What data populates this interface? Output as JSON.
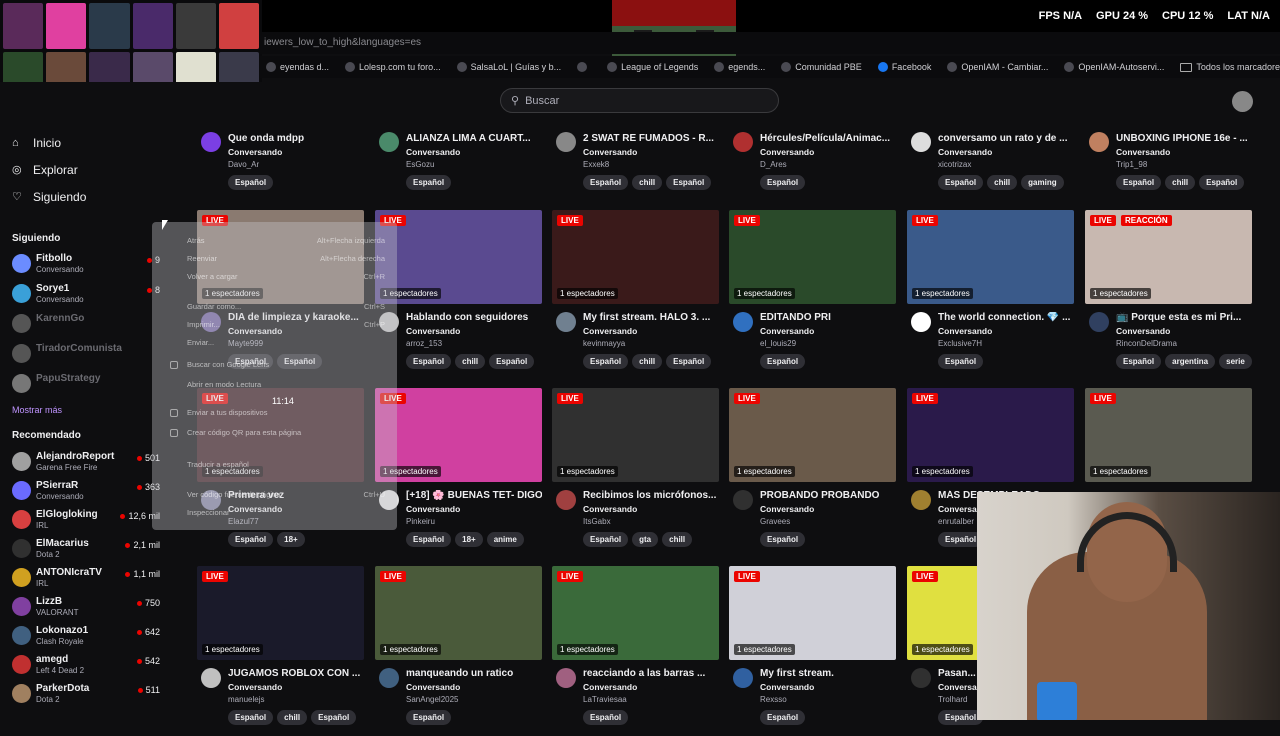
{
  "overlay": {
    "url": "iewers_low_to_high&languages=es",
    "stats": [
      {
        "label": "FPS",
        "value": "N/A"
      },
      {
        "label": "GPU",
        "value": "24 %"
      },
      {
        "label": "CPU",
        "value": "12 %"
      },
      {
        "label": "LAT",
        "value": "N/A"
      }
    ],
    "stream_time": "11:14"
  },
  "bookmarks": [
    {
      "label": "eyendas d...",
      "icon": "page-icon"
    },
    {
      "label": "Lolesp.com tu foro...",
      "icon": "page-icon"
    },
    {
      "label": "SalsaLoL | Guías y b...",
      "icon": "page-icon"
    },
    {
      "label": "",
      "icon": "page-icon"
    },
    {
      "label": "League of Legends",
      "icon": "page-icon"
    },
    {
      "label": "egends...",
      "icon": "page-icon"
    },
    {
      "label": "Comunidad PBE",
      "icon": "page-icon"
    },
    {
      "label": "Facebook",
      "icon": "facebook-icon"
    },
    {
      "label": "OpenIAM - Cambiar...",
      "icon": "page-icon"
    },
    {
      "label": "OpenIAM-Autoservi...",
      "icon": "page-icon"
    }
  ],
  "bookmarks_all": "Todos los marcadores",
  "search": {
    "placeholder": "Buscar"
  },
  "nav": {
    "home": "Inicio",
    "explore": "Explorar",
    "following": "Siguiendo"
  },
  "sidebar": {
    "following_title": "Siguiendo",
    "following": [
      {
        "name": "Fitbollo",
        "game": "Conversando",
        "viewers": "9",
        "online": true,
        "color": "#6b8cff"
      },
      {
        "name": "Sorye1",
        "game": "Conversando",
        "viewers": "8",
        "online": true,
        "color": "#3aa0d8"
      },
      {
        "name": "KarennGo",
        "game": "",
        "viewers": "",
        "online": false,
        "color": "#555"
      },
      {
        "name": "TiradorComunista",
        "game": "",
        "viewers": "",
        "online": false,
        "color": "#555"
      },
      {
        "name": "PapuStrategy",
        "game": "",
        "viewers": "",
        "online": false,
        "color": "#777"
      }
    ],
    "more_label": "Mostrar más",
    "recommended_title": "Recomendado",
    "recommended": [
      {
        "name": "AlejandroReport",
        "game": "Garena Free Fire",
        "viewers": "501",
        "color": "#a0a0a0"
      },
      {
        "name": "PSierraR",
        "game": "Conversando",
        "viewers": "363",
        "color": "#6b6bff"
      },
      {
        "name": "ElGlogloking",
        "game": "IRL",
        "viewers": "12,6 mil",
        "color": "#d84040"
      },
      {
        "name": "ElMacarius",
        "game": "Dota 2",
        "viewers": "2,1 mil",
        "color": "#303030"
      },
      {
        "name": "ANTONIcraTV",
        "game": "IRL",
        "viewers": "1,1 mil",
        "color": "#d0a020"
      },
      {
        "name": "LizzB",
        "game": "VALORANT",
        "viewers": "750",
        "color": "#8040a0"
      },
      {
        "name": "Lokonazo1",
        "game": "Clash Royale",
        "viewers": "642",
        "color": "#406080"
      },
      {
        "name": "amegd",
        "game": "Left 4 Dead 2",
        "viewers": "542",
        "color": "#c03030"
      },
      {
        "name": "ParkerDota",
        "game": "Dota 2",
        "viewers": "511",
        "color": "#a08060"
      }
    ]
  },
  "top_row": [
    {
      "title": "Que onda mdpp",
      "category": "Conversando",
      "user": "Davo_Ar",
      "tags": [
        "Español"
      ],
      "color": "#7b3fe4"
    },
    {
      "title": "ALIANZA LIMA A CUART...",
      "category": "Conversando",
      "user": "EsGozu",
      "tags": [
        "Español"
      ],
      "color": "#4a8a6a"
    },
    {
      "title": "2 SWAT RE FUMADOS - R...",
      "category": "Conversando",
      "user": "Exxek8",
      "tags": [
        "Español",
        "chill",
        "Español"
      ],
      "color": "#888"
    },
    {
      "title": "Hércules/Película/Animac...",
      "category": "Conversando",
      "user": "D_Ares",
      "tags": [
        "Español"
      ],
      "color": "#b03030"
    },
    {
      "title": "conversamo un rato y de ...",
      "category": "Conversando",
      "user": "xicotrizax",
      "tags": [
        "Español",
        "chill",
        "gaming"
      ],
      "color": "#ddd"
    },
    {
      "title": "UNBOXING IPHONE 16e - ...",
      "category": "Conversando",
      "user": "Trip1_98",
      "tags": [
        "Español",
        "chill",
        "Español"
      ],
      "color": "#c08060"
    }
  ],
  "streams": [
    {
      "title": "DIA de limpieza y karaoke...",
      "category": "Conversando",
      "user": "Mayte999",
      "views": "1 espectadores",
      "tags": [
        "Español",
        "Español"
      ],
      "reaction": "",
      "bg": "#8a7a70",
      "color": "#7060a0"
    },
    {
      "title": "Hablando con seguidores",
      "category": "Conversando",
      "user": "arroz_153",
      "views": "1 espectadores",
      "tags": [
        "Español",
        "chill",
        "Español"
      ],
      "reaction": "",
      "bg": "#5a4a90",
      "color": "#c0c0c0"
    },
    {
      "title": "My first stream. HALO 3. ...",
      "category": "Conversando",
      "user": "kevinmayya",
      "views": "1 espectadores",
      "tags": [
        "Español",
        "chill",
        "Español"
      ],
      "reaction": "",
      "bg": "#3a1a1a",
      "color": "#708090"
    },
    {
      "title": "EDITANDO PRI",
      "category": "Conversando",
      "user": "el_louis29",
      "views": "1 espectadores",
      "tags": [
        "Español"
      ],
      "reaction": "",
      "bg": "#2a4a2a",
      "color": "#3070c0"
    },
    {
      "title": "The world connection. 💎 ...",
      "category": "Conversando",
      "user": "Exclusive7H",
      "views": "1 espectadores",
      "tags": [
        "Español"
      ],
      "reaction": "",
      "bg": "#3a5a8a",
      "color": "#fff"
    },
    {
      "title": "📺 Porque esta es mi Pri...",
      "category": "Conversando",
      "user": "RinconDelDrama",
      "views": "1 espectadores",
      "tags": [
        "Español",
        "argentina",
        "serie"
      ],
      "reaction": "REACCIÓN",
      "bg": "#c8b8b0",
      "color": "#304060"
    },
    {
      "title": "Primera vez",
      "category": "Conversando",
      "user": "Elazul77",
      "views": "1 espectadores",
      "tags": [
        "Español",
        "18+"
      ],
      "reaction": "",
      "bg": "#3a1a20",
      "color": "#8080a0"
    },
    {
      "title": "[+18] 🌸 BUENAS TET- DIGO...",
      "category": "Conversando",
      "user": "Pinkeiru",
      "views": "1 espectadores",
      "tags": [
        "Español",
        "18+",
        "anime"
      ],
      "reaction": "",
      "bg": "#d040a0",
      "color": "#e0e0e0"
    },
    {
      "title": "Recibimos los micrófonos...",
      "category": "Conversando",
      "user": "ItsGabx",
      "views": "1 espectadores",
      "tags": [
        "Español",
        "gta",
        "chill"
      ],
      "reaction": "",
      "bg": "#303030",
      "color": "#a04040"
    },
    {
      "title": "PROBANDO PROBANDO",
      "category": "Conversando",
      "user": "Gravees",
      "views": "1 espectadores",
      "tags": [
        "Español"
      ],
      "reaction": "",
      "bg": "#6a5a4a",
      "color": "#303030"
    },
    {
      "title": "MÁS DESEMPLEADO...",
      "category": "Conversando",
      "user": "enrutalber",
      "views": "1 espectadores",
      "tags": [
        "Español"
      ],
      "reaction": "",
      "bg": "#2a1a4a",
      "color": "#a08030"
    },
    {
      "title": "",
      "category": "",
      "user": "",
      "views": "1 espectadores",
      "tags": [],
      "reaction": "",
      "bg": "#5a5a50",
      "color": "#0e0e10"
    },
    {
      "title": "JUGAMOS ROBLOX CON ...",
      "category": "Conversando",
      "user": "manuelejs",
      "views": "1 espectadores",
      "tags": [
        "Español",
        "chill",
        "Español"
      ],
      "reaction": "",
      "bg": "#1a1a2a",
      "color": "#c0c0c0"
    },
    {
      "title": "manqueando un ratico",
      "category": "Conversando",
      "user": "SanAngel2025",
      "views": "1 espectadores",
      "tags": [
        "Español"
      ],
      "reaction": "",
      "bg": "#4a5a3a",
      "color": "#406080"
    },
    {
      "title": "reacciando a las barras ...",
      "category": "Conversando",
      "user": "LaTraviesaa",
      "views": "1 espectadores",
      "tags": [
        "Español"
      ],
      "reaction": "",
      "bg": "#3a6a3a",
      "color": "#a06080"
    },
    {
      "title": "My first stream.",
      "category": "Conversando",
      "user": "Rexsso",
      "views": "1 espectadores",
      "tags": [
        "Español"
      ],
      "reaction": "",
      "bg": "#d0d0d8",
      "color": "#3060a0"
    },
    {
      "title": "Pasan...",
      "category": "Conversa...",
      "user": "Trolhard",
      "views": "1 espectadores",
      "tags": [
        "Español"
      ],
      "reaction": "",
      "bg": "#e0e040",
      "color": "#303030"
    }
  ],
  "context_menu": [
    {
      "label": "Atrás",
      "shortcut": "Alt+Flecha izquierda"
    },
    {
      "label": "Reenviar",
      "shortcut": "Alt+Flecha derecha"
    },
    {
      "label": "Volver a cargar",
      "shortcut": "Ctrl+R"
    },
    {
      "label": "Guardar como...",
      "shortcut": "Ctrl+S"
    },
    {
      "label": "Imprimir...",
      "shortcut": "Ctrl+P"
    },
    {
      "label": "Enviar...",
      "shortcut": ""
    },
    {
      "label": "Buscar con Google Lens",
      "shortcut": ""
    },
    {
      "label": "Abrir en modo Lectura",
      "shortcut": ""
    },
    {
      "label": "Enviar a tus dispositivos",
      "shortcut": ""
    },
    {
      "label": "Crear código QR para esta página",
      "shortcut": ""
    },
    {
      "label": "Traducir a español",
      "shortcut": ""
    },
    {
      "label": "Ver código fuente de página",
      "shortcut": "Ctrl+U"
    },
    {
      "label": "Inspeccionar",
      "shortcut": ""
    }
  ]
}
